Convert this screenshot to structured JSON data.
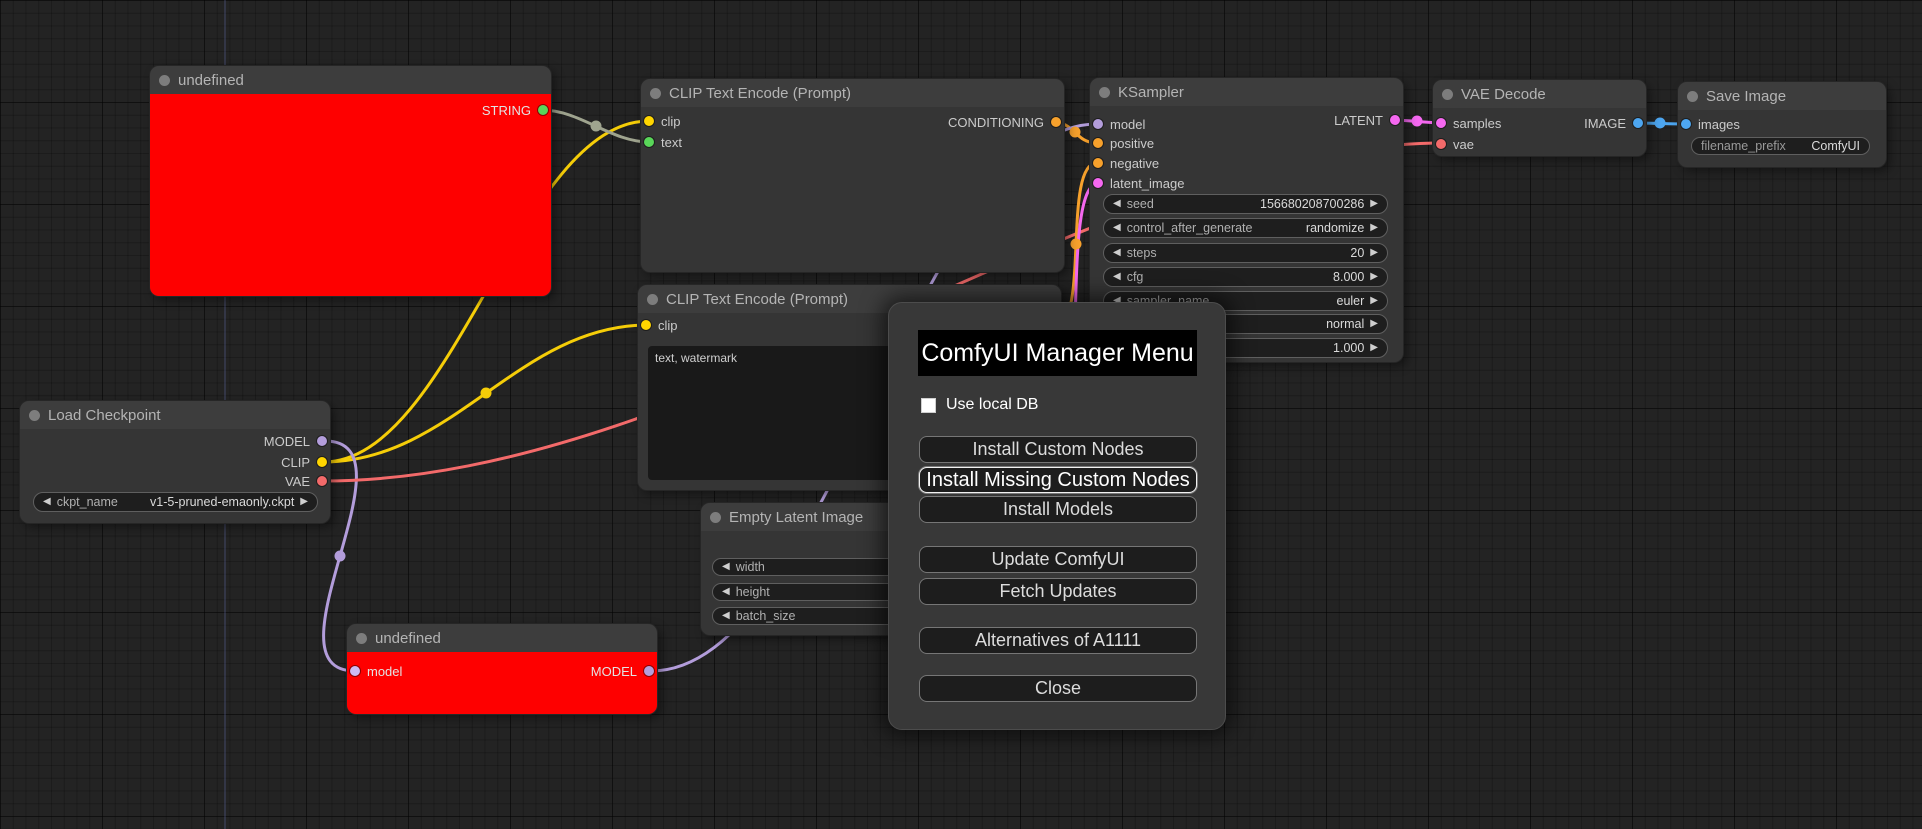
{
  "icons": {
    "left_arrow": "◀",
    "right_arrow": "▶"
  },
  "colors": {
    "node_error_background": "#fe0000",
    "string_port": "#59d659",
    "string_link": "#9fa48f",
    "clip_type": "#ffd500",
    "conditioning_type": "#f7a12c",
    "model_type": "#b39ddb",
    "latent_type": "#f568f0",
    "vae_type": "#f36a6a",
    "image_type": "#4da6f0"
  },
  "nodes": {
    "undefined_top": {
      "title": "undefined",
      "outputs": [
        {
          "label": "STRING"
        }
      ]
    },
    "clip_encode_positive": {
      "title": "CLIP Text Encode (Prompt)",
      "inputs": [
        {
          "label": "clip"
        },
        {
          "label": "text"
        }
      ],
      "outputs": [
        {
          "label": "CONDITIONING"
        }
      ]
    },
    "ksampler": {
      "title": "KSampler",
      "inputs": [
        {
          "label": "model"
        },
        {
          "label": "positive"
        },
        {
          "label": "negative"
        },
        {
          "label": "latent_image"
        }
      ],
      "outputs": [
        {
          "label": "LATENT"
        }
      ],
      "widgets": [
        {
          "label": "seed",
          "value": "156680208700286"
        },
        {
          "label": "control_after_generate",
          "value": "randomize"
        },
        {
          "label": "steps",
          "value": "20"
        },
        {
          "label": "cfg",
          "value": "8.000"
        },
        {
          "label": "sampler_name",
          "value": "euler"
        },
        {
          "label": "",
          "value": "normal"
        },
        {
          "label": "",
          "value": "1.000"
        }
      ]
    },
    "vae_decode": {
      "title": "VAE Decode",
      "inputs": [
        {
          "label": "samples"
        },
        {
          "label": "vae"
        }
      ],
      "outputs": [
        {
          "label": "IMAGE"
        }
      ]
    },
    "save_image": {
      "title": "Save Image",
      "inputs": [
        {
          "label": "images"
        }
      ],
      "widgets": [
        {
          "label": "filename_prefix",
          "value": "ComfyUI"
        }
      ]
    },
    "load_checkpoint": {
      "title": "Load Checkpoint",
      "outputs": [
        {
          "label": "MODEL"
        },
        {
          "label": "CLIP"
        },
        {
          "label": "VAE"
        }
      ],
      "widgets": [
        {
          "label": "ckpt_name",
          "value": "v1-5-pruned-emaonly.ckpt"
        }
      ]
    },
    "clip_encode_negative": {
      "title": "CLIP Text Encode (Prompt)",
      "inputs": [
        {
          "label": "clip"
        }
      ],
      "text_value": "text, watermark"
    },
    "empty_latent": {
      "title": "Empty Latent Image",
      "widgets": [
        {
          "label": "width",
          "value": ""
        },
        {
          "label": "height",
          "value": ""
        },
        {
          "label": "batch_size",
          "value": ""
        }
      ]
    },
    "undefined_bottom": {
      "title": "undefined",
      "inputs": [
        {
          "label": "model"
        }
      ],
      "outputs": [
        {
          "label": "MODEL"
        }
      ]
    }
  },
  "dialog": {
    "title": "ComfyUI Manager Menu",
    "checkbox_label": "Use local DB",
    "buttons": [
      {
        "label": "Install Custom Nodes"
      },
      {
        "label": "Install Missing Custom Nodes"
      },
      {
        "label": "Install Models"
      },
      {
        "label": "Update ComfyUI"
      },
      {
        "label": "Fetch Updates"
      },
      {
        "label": "Alternatives of A1111"
      },
      {
        "label": "Close"
      }
    ]
  }
}
